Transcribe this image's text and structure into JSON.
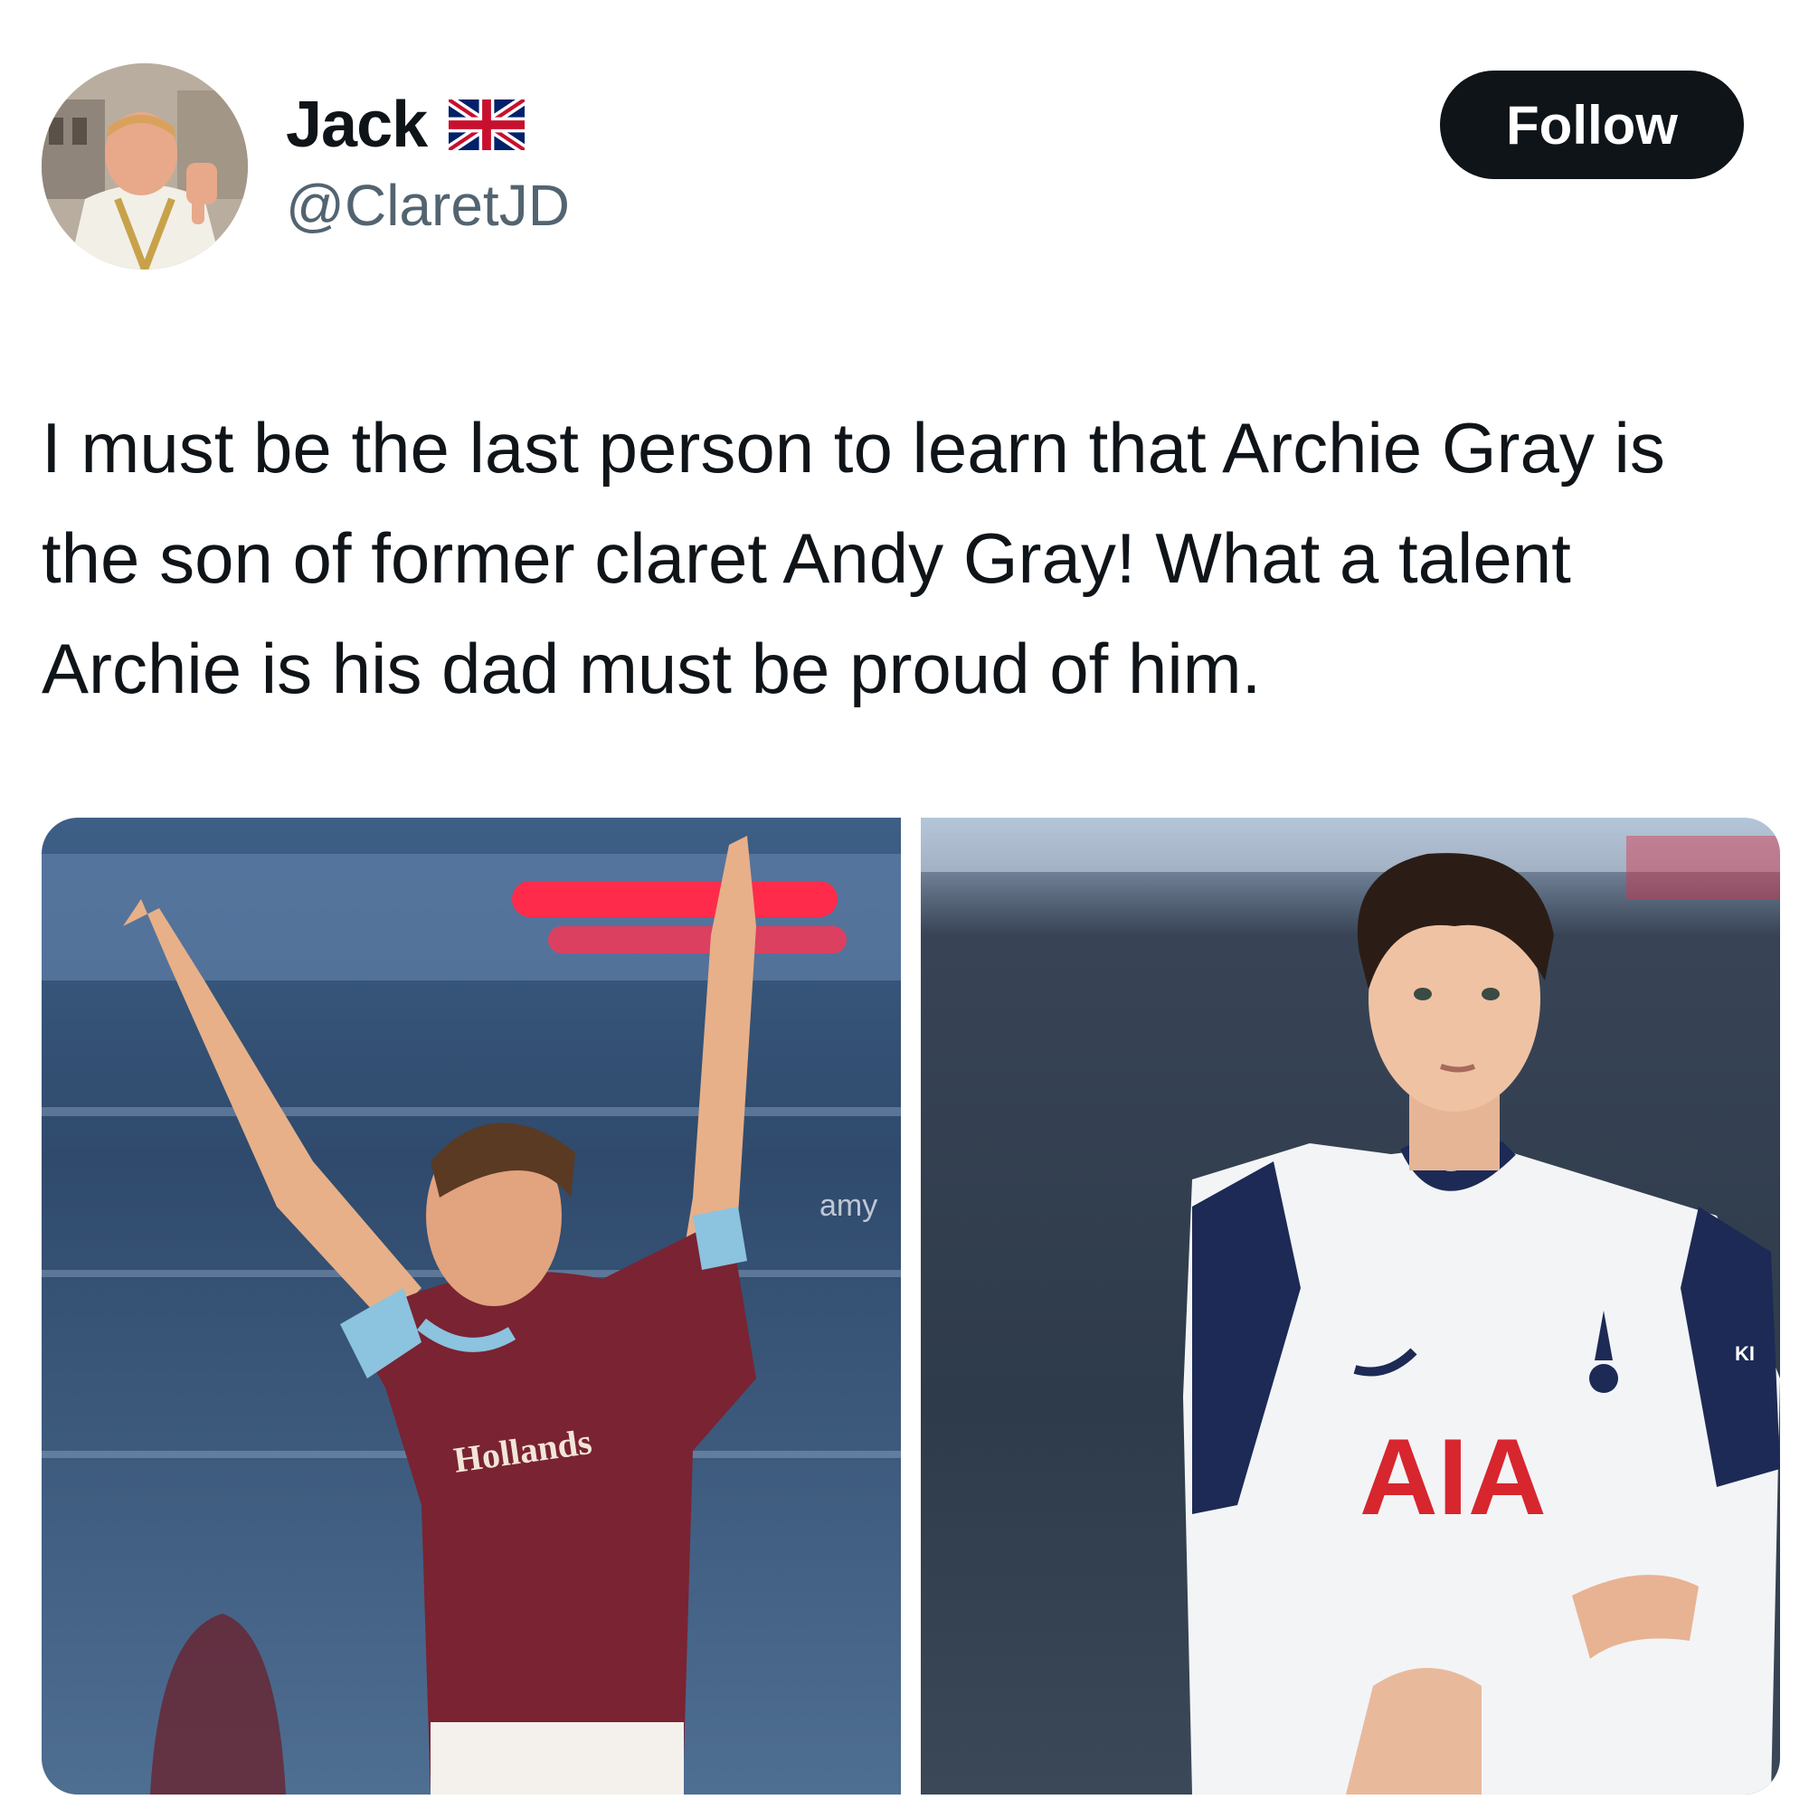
{
  "author": {
    "display_name": "Jack",
    "flag_icon": "uk-flag-icon",
    "handle": "@ClaretJD",
    "avatar_icon": "avatar-thumbs-down"
  },
  "actions": {
    "follow_label": "Follow"
  },
  "tweet": {
    "text": "I must be the last person to learn that Archie Gray is the son of former claret Andy Gray! What a talent Archie is his dad must be proud of him."
  },
  "media": {
    "photo_1": {
      "shirt_sponsor": "Hollands",
      "watermark": "amy"
    },
    "photo_2": {
      "shirt_sponsor": "AIA",
      "sleeve_sponsor": "KI"
    }
  },
  "colors": {
    "text_primary": "#0f1419",
    "text_secondary": "#536471",
    "button_bg": "#0f1419",
    "button_text": "#ffffff",
    "claret": "#7a2332",
    "sky_blue": "#8cc3df",
    "spurs_navy": "#1c2a55",
    "aia_red": "#d7262e"
  }
}
